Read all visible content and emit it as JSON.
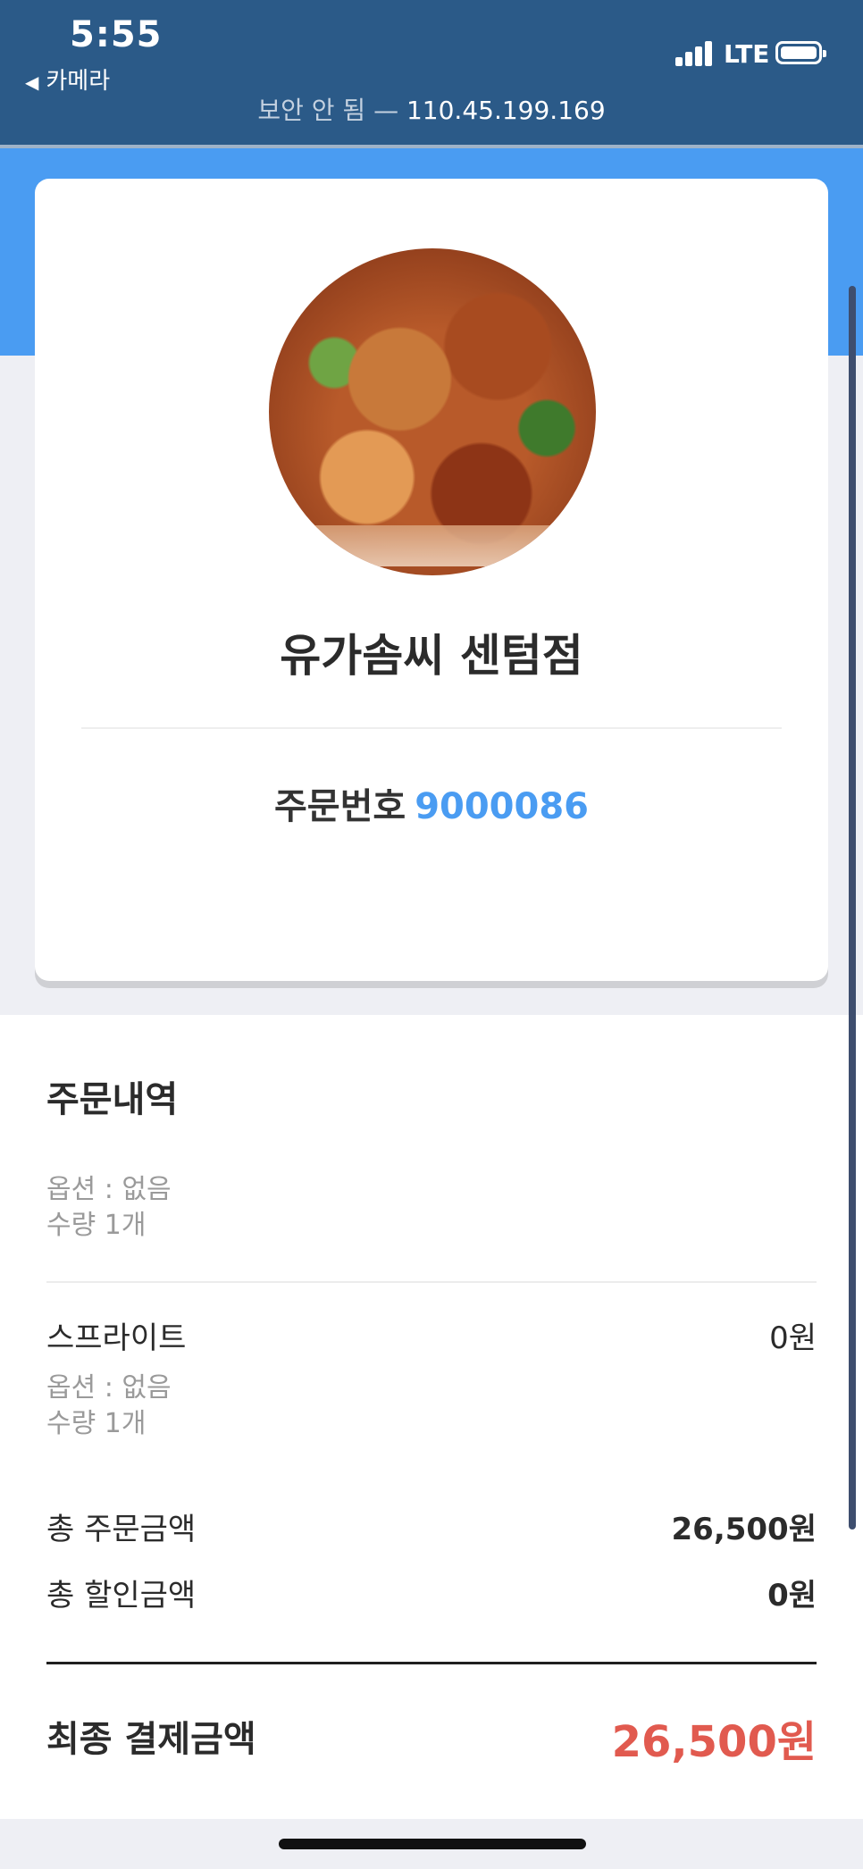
{
  "status_bar": {
    "time": "5:55",
    "back_label": "카메라",
    "network": "LTE"
  },
  "url_bar": {
    "insecure_label": "보안 안 됨",
    "separator": "—",
    "address": "110.45.199.169"
  },
  "store": {
    "name": "유가솜씨 센텀점",
    "order_label": "주문번호",
    "order_number": "9000086"
  },
  "order": {
    "title": "주문내역",
    "items": [
      {
        "name": "",
        "price": "",
        "option": "옵션 : 없음",
        "quantity": "수량 1개"
      },
      {
        "name": "스프라이트",
        "price": "0원",
        "option": "옵션 : 없음",
        "quantity": "수량 1개"
      }
    ],
    "summary": {
      "total_label": "총 주문금액",
      "total_value": "26,500원",
      "discount_label": "총 할인금액",
      "discount_value": "0원"
    },
    "final": {
      "label": "최종 결제금액",
      "value": "26,500원"
    }
  },
  "colors": {
    "status_bar": "#2b5a88",
    "accent_blue": "#4a9cf2",
    "final_price_red": "#e15a4f",
    "page_bg": "#eeeff4"
  }
}
